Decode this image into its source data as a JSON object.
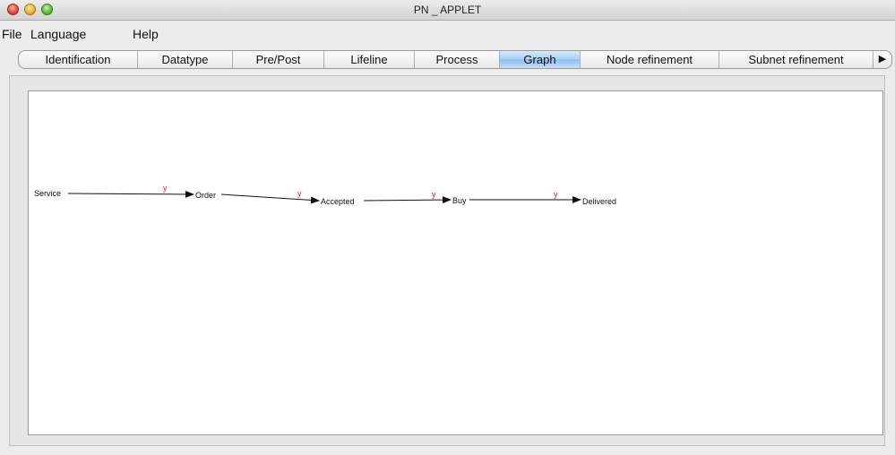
{
  "window": {
    "title": "PN _ APPLET"
  },
  "menu": [
    "File",
    "Language",
    "Help"
  ],
  "tabs": [
    "Identification",
    "Datatype",
    "Pre/Post",
    "Lifeline",
    "Process",
    "Graph",
    "Node refinement",
    "Subnet refinement"
  ],
  "active_tab": "Graph",
  "graph": {
    "nodes": [
      "Service",
      "Order",
      "Accepted",
      "Buy",
      "Delivered"
    ],
    "edges": [
      {
        "from": "Service",
        "to": "Order",
        "label": "y"
      },
      {
        "from": "Order",
        "to": "Accepted",
        "label": "y"
      },
      {
        "from": "Accepted",
        "to": "Buy",
        "label": "y"
      },
      {
        "from": "Buy",
        "to": "Delivered",
        "label": "y"
      }
    ]
  },
  "colors": {
    "edge_label": "#e02020",
    "active_tab": "#a7cdf3"
  }
}
